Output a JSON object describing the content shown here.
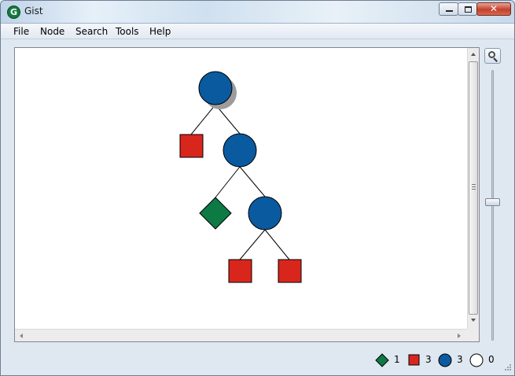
{
  "window": {
    "title": "Gist",
    "app_icon_letter": "G",
    "close_glyph": "✕"
  },
  "menu": {
    "items": [
      "File",
      "Node",
      "Search",
      "Tools",
      "Help"
    ]
  },
  "tree": {
    "nodes": [
      {
        "id": "n0",
        "type": "branch",
        "shape": "circle",
        "color": "#0a5aa0",
        "selected_shadow": true
      },
      {
        "id": "n1",
        "type": "failed",
        "shape": "square",
        "color": "#d9261c"
      },
      {
        "id": "n2",
        "type": "branch",
        "shape": "circle",
        "color": "#0a5aa0"
      },
      {
        "id": "n3",
        "type": "solution",
        "shape": "diamond",
        "color": "#0d7a44"
      },
      {
        "id": "n4",
        "type": "branch",
        "shape": "circle",
        "color": "#0a5aa0"
      },
      {
        "id": "n5",
        "type": "failed",
        "shape": "square",
        "color": "#d9261c"
      },
      {
        "id": "n6",
        "type": "failed",
        "shape": "square",
        "color": "#d9261c"
      }
    ],
    "edges": [
      [
        "n0",
        "n1"
      ],
      [
        "n0",
        "n2"
      ],
      [
        "n2",
        "n3"
      ],
      [
        "n2",
        "n4"
      ],
      [
        "n4",
        "n5"
      ],
      [
        "n4",
        "n6"
      ]
    ]
  },
  "status": {
    "solutions": "1",
    "failures": "3",
    "choices": "3",
    "open": "0",
    "colors": {
      "solution": "#0d7a44",
      "failure": "#d9261c",
      "choice": "#0a5aa0",
      "open": "#ffffff"
    }
  }
}
